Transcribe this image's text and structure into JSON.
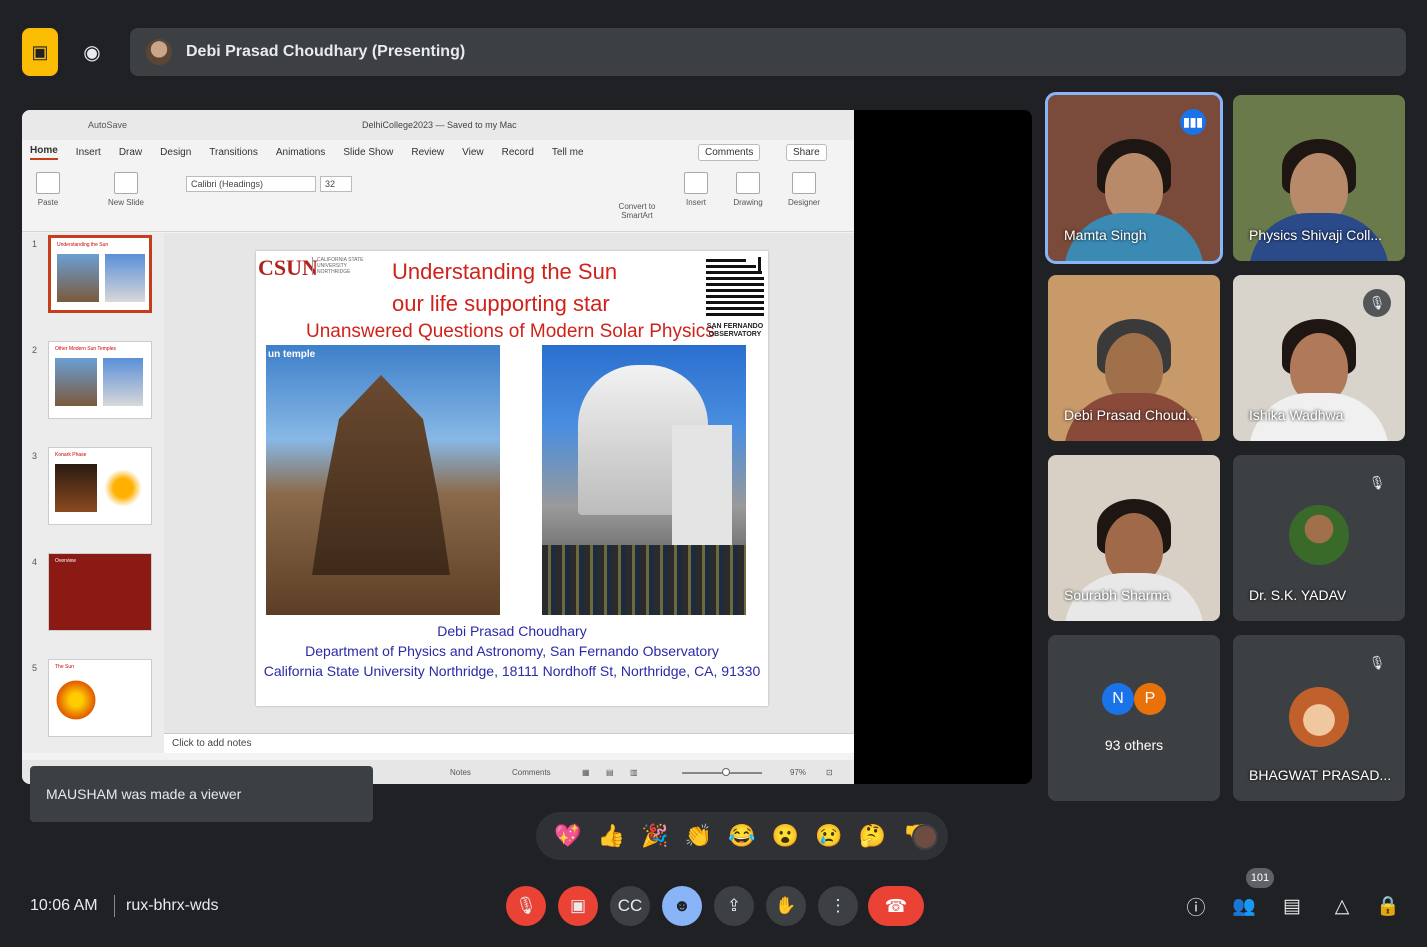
{
  "top_bar": {
    "presenter_label": "Debi Prasad Choudhary (Presenting)"
  },
  "powerpoint": {
    "autosave": "AutoSave",
    "doc_title": "DelhiCollege2023 — Saved to my Mac",
    "menu": [
      "Home",
      "Insert",
      "Draw",
      "Design",
      "Transitions",
      "Animations",
      "Slide Show",
      "Review",
      "View",
      "Record",
      "Tell me"
    ],
    "active_menu": "Home",
    "comments_label": "Comments",
    "share_label": "Share",
    "ribbon": {
      "paste": "Paste",
      "new_slide": "New Slide",
      "font": "Calibri (Headings)",
      "font_size": "32",
      "convert": "Convert to SmartArt",
      "insert": "Insert",
      "drawing": "Drawing",
      "designer": "Designer"
    },
    "thumbnails": [
      {
        "num": "1",
        "title": "Understanding the Sun"
      },
      {
        "num": "2",
        "title": "Other Modern Sun Temples"
      },
      {
        "num": "3",
        "title": "Konark Phase"
      },
      {
        "num": "4",
        "title": "Overview"
      },
      {
        "num": "5",
        "title": "The Sun"
      }
    ],
    "notes_placeholder": "Click to add notes",
    "status": {
      "notes": "Notes",
      "comments": "Comments",
      "zoom": "97%"
    },
    "slide": {
      "logo_csun": "CSUN",
      "logo_sub": "CALIFORNIA STATE UNIVERSITY NORTHRIDGE",
      "title_line1": "Understanding the Sun",
      "title_line2": "our life supporting star",
      "title_line3": "Unanswered Questions of Modern Solar Physics",
      "sfo_label": "SAN FERNANDO OBSERVATORY",
      "temple_caption": "un temple",
      "author": "Debi Prasad Choudhary",
      "department": "Department of Physics and Astronomy, San Fernando Observatory",
      "university": "California State University Northridge, 18111 Nordhoff St, Northridge, CA, 91330"
    }
  },
  "toast": "MAUSHAM was made a viewer",
  "participants": [
    {
      "name": "Mamta Singh",
      "speaking": true
    },
    {
      "name": "Physics Shivaji Coll...",
      "muted": false
    },
    {
      "name": "Debi Prasad Choud...",
      "muted": false
    },
    {
      "name": "Ishika Wadhwa",
      "muted": true
    },
    {
      "name": "Sourabh Sharma",
      "muted": false
    },
    {
      "name": "Dr. S.K. YADAV",
      "muted": true
    },
    {
      "name": "93 others",
      "initials": [
        "N",
        "P"
      ]
    },
    {
      "name": "BHAGWAT PRASAD...",
      "muted": true
    }
  ],
  "reactions": [
    "💖",
    "👍",
    "🎉",
    "👏",
    "😂",
    "😮",
    "😢",
    "🤔",
    "👎"
  ],
  "bottom_bar": {
    "time": "10:06 AM",
    "meeting_code": "rux-bhrx-wds",
    "people_count": "101"
  },
  "colors": {
    "bg": "#202124",
    "tile": "#3c4043",
    "red": "#ea4335",
    "blue": "#1a73e8",
    "present_yellow": "#fbbc04",
    "slide_red": "#d0221b",
    "slide_blue": "#2a2aa8"
  }
}
